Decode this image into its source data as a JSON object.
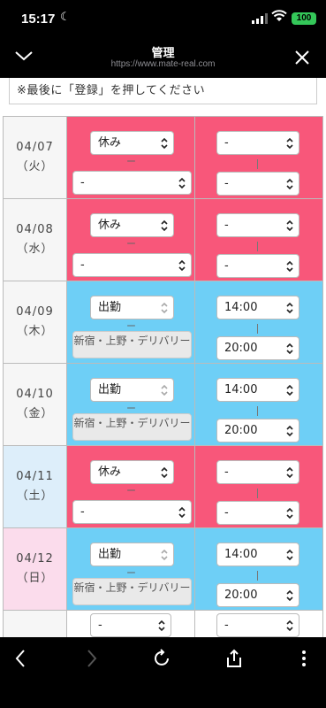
{
  "status": {
    "time": "15:17",
    "battery": "100"
  },
  "browser": {
    "title": "管理",
    "url": "https://www.mate-real.com"
  },
  "notice": "※最後に「登録」を押してください",
  "rows": [
    {
      "date": "04/07",
      "dow": "（火）",
      "type": "休み",
      "shop": "-",
      "start": "-",
      "end": "-"
    },
    {
      "date": "04/08",
      "dow": "（水）",
      "type": "休み",
      "shop": "-",
      "start": "-",
      "end": "-"
    },
    {
      "date": "04/09",
      "dow": "（木）",
      "type": "出勤",
      "shop": "新宿・上野・デリバリー",
      "start": "14:00",
      "end": "20:00"
    },
    {
      "date": "04/10",
      "dow": "（金）",
      "type": "出勤",
      "shop": "新宿・上野・デリバリー",
      "start": "14:00",
      "end": "20:00"
    },
    {
      "date": "04/11",
      "dow": "（土）",
      "type": "休み",
      "shop": "-",
      "start": "-",
      "end": "-"
    },
    {
      "date": "04/12",
      "dow": "（日）",
      "type": "出勤",
      "shop": "新宿・上野・デリバリー",
      "start": "14:00",
      "end": "20:00"
    },
    {
      "date": "",
      "dow": "",
      "type": "-",
      "shop": "",
      "start": "-",
      "end": ""
    }
  ],
  "separator": "ー",
  "colors": {
    "off": "#f8577a",
    "work": "#6ecff6",
    "saturday": "#ddeefa",
    "sunday": "#fbdcec"
  }
}
